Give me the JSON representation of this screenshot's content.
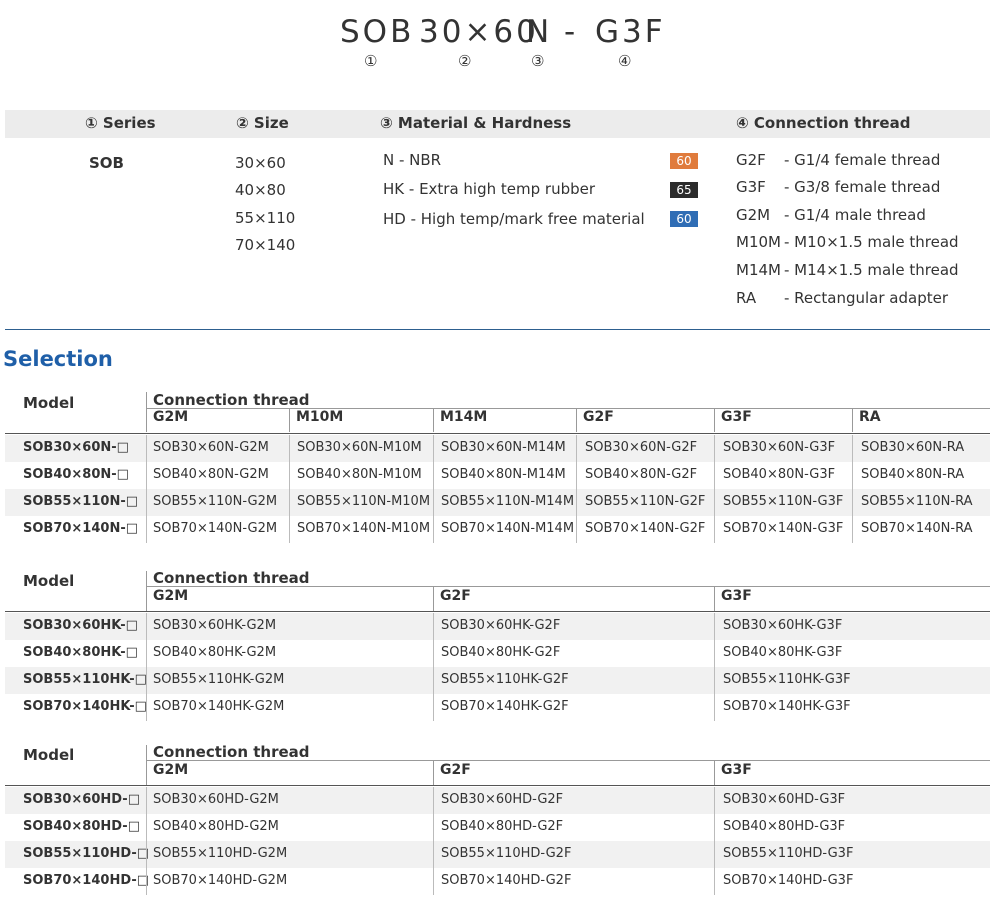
{
  "code": {
    "parts": [
      "SOB",
      "30×60",
      "N",
      "-",
      "G3F"
    ],
    "numbers": [
      "①",
      "②",
      "③",
      "④"
    ]
  },
  "legend": {
    "headers": [
      "① Series",
      "② Size",
      "③ Material & Hardness",
      "④ Connection thread"
    ],
    "series": "SOB",
    "sizes": [
      "30×60",
      "40×80",
      "55×110",
      "70×140"
    ],
    "materials": [
      {
        "label": "N - NBR",
        "hardness": "60",
        "color": "#e07b3c"
      },
      {
        "label": "HK - Extra high temp rubber",
        "hardness": "65",
        "color": "#2b2b2b"
      },
      {
        "label": "HD - High temp/mark free material",
        "hardness": "60",
        "color": "#2f6db5"
      }
    ],
    "threads": [
      {
        "code": "G2F",
        "desc": "- G1/4 female thread"
      },
      {
        "code": "G3F",
        "desc": "- G3/8 female thread"
      },
      {
        "code": "G2M",
        "desc": "- G1/4 male thread"
      },
      {
        "code": "M10M",
        "desc": "- M10×1.5 male thread"
      },
      {
        "code": "M14M",
        "desc": "- M14×1.5 male thread"
      },
      {
        "code": "RA",
        "desc": "- Rectangular adapter"
      }
    ]
  },
  "selection_title": "Selection",
  "tables": [
    {
      "model_label": "Model",
      "group_label": "Connection thread",
      "columns": [
        "G2M",
        "M10M",
        "M14M",
        "G2F",
        "G3F",
        "RA"
      ],
      "rows": [
        {
          "model": "SOB30×60N-□",
          "cells": [
            "SOB30×60N-G2M",
            "SOB30×60N-M10M",
            "SOB30×60N-M14M",
            "SOB30×60N-G2F",
            "SOB30×60N-G3F",
            "SOB30×60N-RA"
          ]
        },
        {
          "model": "SOB40×80N-□",
          "cells": [
            "SOB40×80N-G2M",
            "SOB40×80N-M10M",
            "SOB40×80N-M14M",
            "SOB40×80N-G2F",
            "SOB40×80N-G3F",
            "SOB40×80N-RA"
          ]
        },
        {
          "model": "SOB55×110N-□",
          "cells": [
            "SOB55×110N-G2M",
            "SOB55×110N-M10M",
            "SOB55×110N-M14M",
            "SOB55×110N-G2F",
            "SOB55×110N-G3F",
            "SOB55×110N-RA"
          ]
        },
        {
          "model": "SOB70×140N-□",
          "cells": [
            "SOB70×140N-G2M",
            "SOB70×140N-M10M",
            "SOB70×140N-M14M",
            "SOB70×140N-G2F",
            "SOB70×140N-G3F",
            "SOB70×140N-RA"
          ]
        }
      ]
    },
    {
      "model_label": "Model",
      "group_label": "Connection thread",
      "columns": [
        "G2M",
        "G2F",
        "G3F"
      ],
      "rows": [
        {
          "model": "SOB30×60HK-□",
          "cells": [
            "SOB30×60HK-G2M",
            "SOB30×60HK-G2F",
            "SOB30×60HK-G3F"
          ]
        },
        {
          "model": "SOB40×80HK-□",
          "cells": [
            "SOB40×80HK-G2M",
            "SOB40×80HK-G2F",
            "SOB40×80HK-G3F"
          ]
        },
        {
          "model": "SOB55×110HK-□",
          "cells": [
            "SOB55×110HK-G2M",
            "SOB55×110HK-G2F",
            "SOB55×110HK-G3F"
          ]
        },
        {
          "model": "SOB70×140HK-□",
          "cells": [
            "SOB70×140HK-G2M",
            "SOB70×140HK-G2F",
            "SOB70×140HK-G3F"
          ]
        }
      ]
    },
    {
      "model_label": "Model",
      "group_label": "Connection thread",
      "columns": [
        "G2M",
        "G2F",
        "G3F"
      ],
      "rows": [
        {
          "model": "SOB30×60HD-□",
          "cells": [
            "SOB30×60HD-G2M",
            "SOB30×60HD-G2F",
            "SOB30×60HD-G3F"
          ]
        },
        {
          "model": "SOB40×80HD-□",
          "cells": [
            "SOB40×80HD-G2M",
            "SOB40×80HD-G2F",
            "SOB40×80HD-G3F"
          ]
        },
        {
          "model": "SOB55×110HD-□",
          "cells": [
            "SOB55×110HD-G2M",
            "SOB55×110HD-G2F",
            "SOB55×110HD-G3F"
          ]
        },
        {
          "model": "SOB70×140HD-□",
          "cells": [
            "SOB70×140HD-G2M",
            "SOB70×140HD-G2F",
            "SOB70×140HD-G3F"
          ]
        }
      ]
    }
  ]
}
